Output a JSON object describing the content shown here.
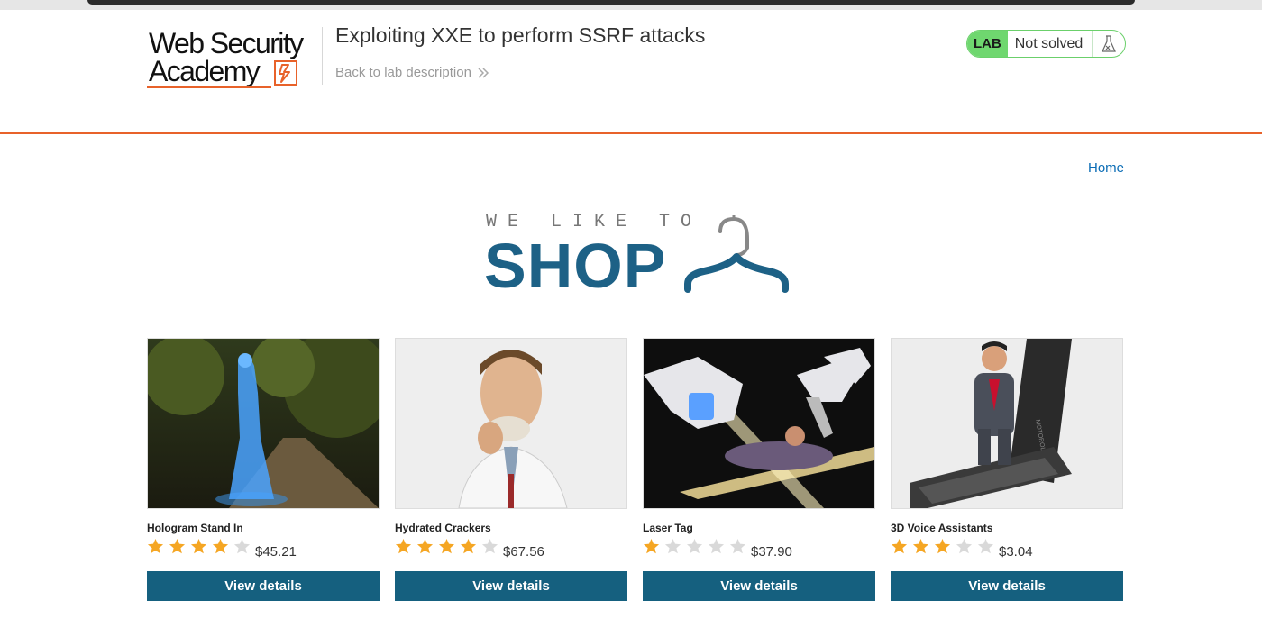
{
  "header": {
    "logo_line1": "Web Security",
    "logo_line2": "Academy",
    "lab_title": "Exploiting XXE to perform SSRF attacks",
    "back_link": "Back to lab description",
    "status_lab": "LAB",
    "status_text": "Not solved",
    "status_icon": "flask-icon"
  },
  "nav": {
    "home": "Home"
  },
  "banner": {
    "top": "WE LIKE TO",
    "main": "SHOP",
    "icon": "hanger-icon"
  },
  "colors": {
    "accent": "#e8622a",
    "primary": "#15607f",
    "link": "#0a6cb5",
    "star_on": "#f5a623",
    "star_off": "#d9d9d9",
    "lab_green": "#6fd76f"
  },
  "products": [
    {
      "name": "Hologram Stand In",
      "price": "$45.21",
      "rating": 4,
      "button": "View details"
    },
    {
      "name": "Hydrated Crackers",
      "price": "$67.56",
      "rating": 4,
      "button": "View details"
    },
    {
      "name": "Laser Tag",
      "price": "$37.90",
      "rating": 1,
      "button": "View details"
    },
    {
      "name": "3D Voice Assistants",
      "price": "$3.04",
      "rating": 3,
      "button": "View details"
    }
  ]
}
